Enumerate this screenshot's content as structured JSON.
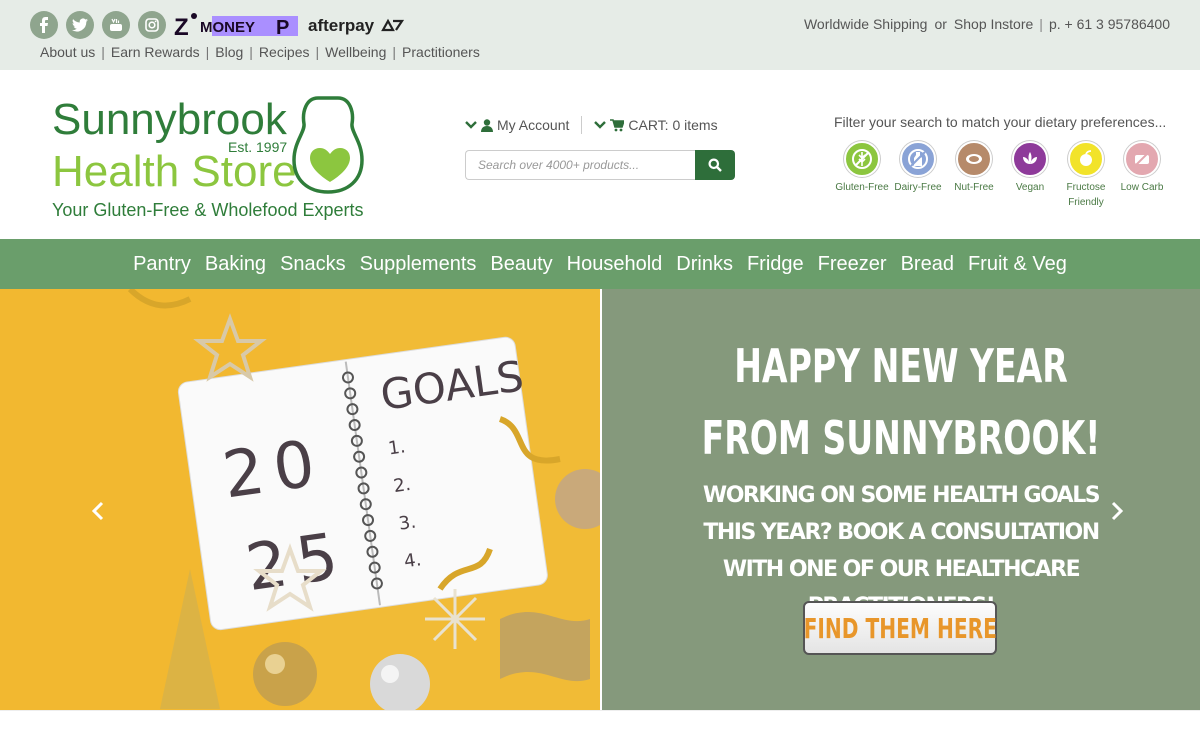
{
  "topbar": {
    "social": [
      "facebook-icon",
      "twitter-icon",
      "youtube-icon",
      "instagram-icon"
    ],
    "zip_logo": "ZIMONEY P",
    "afterpay_logo": "afterpay",
    "links": [
      "About us",
      "Earn Rewards",
      "Blog",
      "Recipes",
      "Wellbeing",
      "Practitioners"
    ],
    "right": {
      "shipping": "Worldwide Shipping",
      "or": "or",
      "instore": "Shop Instore",
      "phone": "p. + 61 3 95786400"
    }
  },
  "logo": {
    "line1": "Sunnybrook",
    "line2": "Health Store",
    "est": "Est. 1997",
    "tagline": "Your Gluten-Free & Wholefood Experts"
  },
  "account": {
    "my_account": "My Account",
    "cart": "CART: 0 items"
  },
  "search": {
    "placeholder": "Search over 4000+ products..."
  },
  "filters": {
    "title": "Filter your search to match your dietary preferences...",
    "items": [
      {
        "label": "Gluten-Free",
        "color": "#8cc63f"
      },
      {
        "label": "Dairy-Free",
        "color": "#8aa3d6"
      },
      {
        "label": "Nut-Free",
        "color": "#b68a6a"
      },
      {
        "label": "Vegan",
        "color": "#8e3a9a"
      },
      {
        "label": "Fructose Friendly",
        "color": "#f2e32a"
      },
      {
        "label": "Low Carb",
        "color": "#e3a8b0"
      }
    ]
  },
  "nav": [
    "Pantry",
    "Baking",
    "Snacks",
    "Supplements",
    "Beauty",
    "Household",
    "Drinks",
    "Fridge",
    "Freezer",
    "Bread",
    "Fruit & Veg"
  ],
  "hero": {
    "notebook": {
      "goals": "GOALS",
      "year_top": "20",
      "year_bottom": "25",
      "list": [
        "1.",
        "2.",
        "3.",
        "4."
      ]
    },
    "line1": "HAPPY NEW YEAR",
    "line2": "FROM SUNNYBROOK!",
    "sub": "WORKING ON SOME HEALTH GOALS THIS YEAR? BOOK A CONSULTATION WITH ONE OF OUR HEALTHCARE PRACTITIONERS!",
    "cta": "FIND THEM HERE"
  },
  "colors": {
    "nav": "#6a9e6b",
    "hero_right": "#85997c",
    "hero_left": "#f2b830",
    "brand_green": "#2e6e3a",
    "cta_text": "#e8962a"
  }
}
